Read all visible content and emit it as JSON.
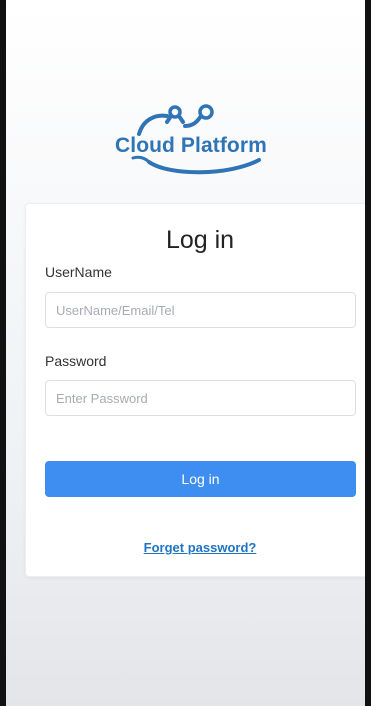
{
  "brand": {
    "name": "Cloud Platform",
    "logo_icon": "cloud-network-logo",
    "color": "#2f74b5"
  },
  "login_card": {
    "title": "Log in",
    "username": {
      "label": "UserName",
      "value": "",
      "placeholder": "UserName/Email/Tel"
    },
    "password": {
      "label": "Password",
      "value": "",
      "placeholder": "Enter Password"
    },
    "submit_label": "Log in",
    "forgot_label": "Forget password?"
  },
  "colors": {
    "accent": "#3d8ef0",
    "link": "#1f74c4"
  }
}
